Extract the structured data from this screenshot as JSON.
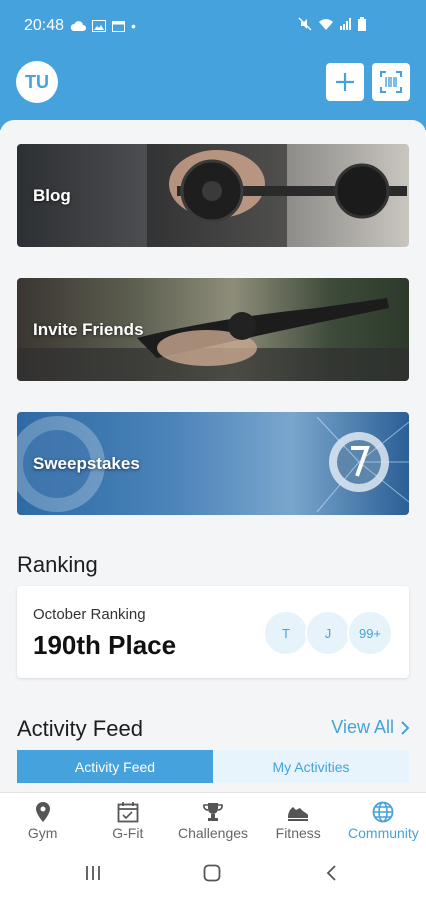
{
  "status_bar": {
    "time": "20:48",
    "dot": "•"
  },
  "header": {
    "avatar_initials": "TU"
  },
  "banners": [
    {
      "title": "Blog"
    },
    {
      "title": "Invite Friends"
    },
    {
      "title": "Sweepstakes"
    }
  ],
  "ranking": {
    "section_title": "Ranking",
    "subtitle": "October Ranking",
    "place": "190th Place",
    "bubbles": [
      "T",
      "J",
      "99+"
    ]
  },
  "activity": {
    "section_title": "Activity Feed",
    "view_all": "View All",
    "tabs": [
      {
        "label": "Activity Feed",
        "active": true
      },
      {
        "label": "My Activities",
        "active": false
      }
    ]
  },
  "bottom_nav": [
    {
      "label": "Gym",
      "icon": "location-pin-icon"
    },
    {
      "label": "G-Fit",
      "icon": "calendar-icon"
    },
    {
      "label": "Challenges",
      "icon": "trophy-icon"
    },
    {
      "label": "Fitness",
      "icon": "shoe-icon"
    },
    {
      "label": "Community",
      "icon": "globe-icon",
      "active": true
    }
  ],
  "colors": {
    "accent": "#45a2dc",
    "background": "#f4f5f7"
  }
}
